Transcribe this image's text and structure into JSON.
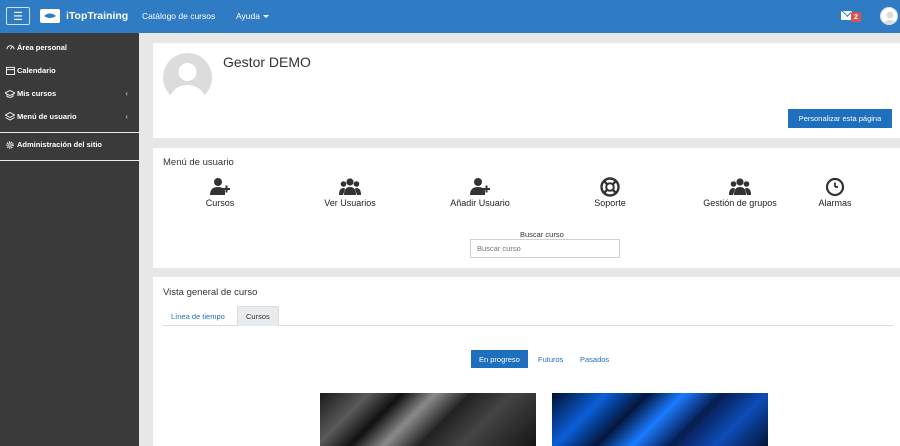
{
  "navbar": {
    "brand": "iTopTraining",
    "links": [
      "Catálogo de cursos",
      "Ayuda"
    ],
    "notification_count": "2",
    "colors": {
      "bar": "#2f7bc4"
    }
  },
  "sidebar": {
    "items": [
      {
        "label": "Área personal",
        "icon": "dashboard-icon"
      },
      {
        "label": "Calendario",
        "icon": "calendar-icon"
      },
      {
        "label": "Mis cursos",
        "icon": "graduation-cap-icon"
      },
      {
        "label": "Menú de usuario",
        "icon": "layers-icon"
      },
      {
        "label": "Administración del sitio",
        "icon": "gear-icon"
      }
    ]
  },
  "header": {
    "name": "Gestor DEMO",
    "customize_label": "Personalizar esta página"
  },
  "user_menu": {
    "title": "Menú de usuario",
    "items": [
      {
        "label": "Cursos",
        "icon": "user-plus-icon"
      },
      {
        "label": "Ver Usuarios",
        "icon": "users-icon"
      },
      {
        "label": "Añadir Usuario",
        "icon": "user-plus-icon"
      },
      {
        "label": "Soporte",
        "icon": "life-ring-icon"
      },
      {
        "label": "Gestión de grupos",
        "icon": "users-icon"
      },
      {
        "label": "Alarmas",
        "icon": "clock-icon"
      }
    ],
    "search_label": "Buscar curso",
    "search_placeholder": "Buscar curso"
  },
  "overview": {
    "title": "Vista general de curso",
    "tabs": [
      "Línea de tiempo",
      "Cursos"
    ],
    "filters": [
      "En progreso",
      "Futuros",
      "Pasados"
    ]
  }
}
